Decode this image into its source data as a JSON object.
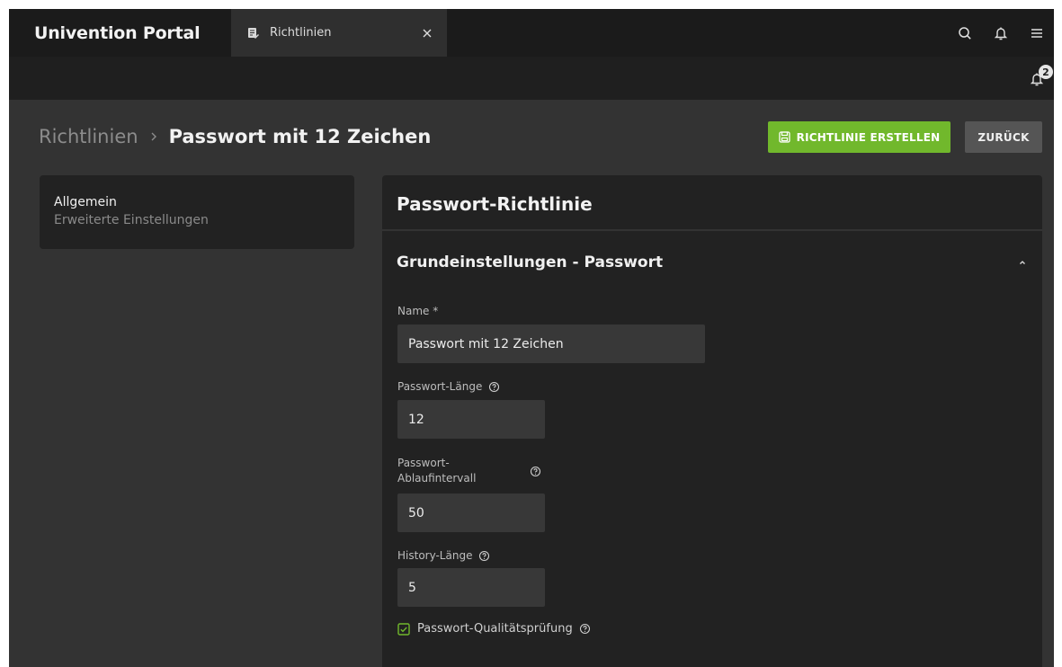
{
  "app": {
    "title": "Univention Portal",
    "tab": {
      "label": "Richtlinien",
      "icon": "policy-doc-icon",
      "close_icon": "close-icon"
    },
    "top_icons": [
      "search-icon",
      "bell-icon",
      "menu-icon"
    ],
    "notifications": {
      "icon": "bell-icon",
      "count": "2"
    }
  },
  "header": {
    "breadcrumb_parent": "Richtlinien",
    "breadcrumb_current": "Passwort mit 12 Zeichen",
    "create_button": "RICHTLINIE ERSTELLEN",
    "back_button": "ZURÜCK"
  },
  "sidenav": {
    "items": [
      {
        "label": "Allgemein",
        "active": true
      },
      {
        "label": "Erweiterte Einstellungen",
        "active": false
      }
    ]
  },
  "panel": {
    "title": "Passwort-Richtlinie",
    "section_title": "Grundeinstellungen - Passwort",
    "fields": {
      "name_label": "Name *",
      "name_value": "Passwort mit 12 Zeichen",
      "length_label": "Passwort-Länge",
      "length_value": "12",
      "expiry_label_1": "Passwort-",
      "expiry_label_2": "Ablaufintervall",
      "expiry_value": "50",
      "history_label": "History-Länge",
      "history_value": "5",
      "quality_check_label": "Passwort-Qualitätsprüfung",
      "quality_check_checked": true
    }
  },
  "colors": {
    "accent": "#71b82c",
    "background": "#333333",
    "topbar": "#1b1b1b",
    "panel": "#222222"
  }
}
